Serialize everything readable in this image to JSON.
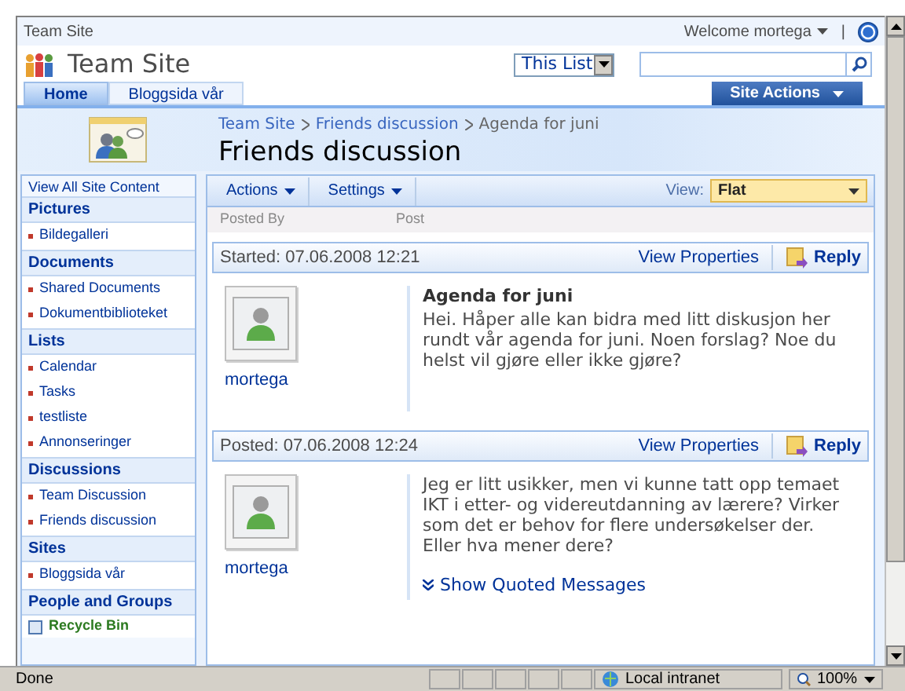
{
  "global_bar": {
    "site": "Team Site",
    "welcome": "Welcome mortega",
    "separator": "|"
  },
  "title_row": {
    "title": "Team Site",
    "scope": "This List"
  },
  "tabs": [
    {
      "label": "Home",
      "selected": true
    },
    {
      "label": "Bloggsida vår",
      "selected": false
    }
  ],
  "site_actions": "Site Actions",
  "breadcrumb": [
    {
      "label": "Team Site",
      "link": true
    },
    {
      "label": "Friends discussion",
      "link": true
    },
    {
      "label": "Agenda for juni",
      "link": false
    }
  ],
  "page_title": "Friends discussion",
  "sidebar": {
    "view_all": "View All Site Content",
    "groups": [
      {
        "title": "Pictures",
        "items": [
          "Bildegalleri"
        ]
      },
      {
        "title": "Documents",
        "items": [
          "Shared Documents",
          "Dokumentbiblioteket"
        ]
      },
      {
        "title": "Lists",
        "items": [
          "Calendar",
          "Tasks",
          "testliste",
          "Annonseringer"
        ]
      },
      {
        "title": "Discussions",
        "items": [
          "Team Discussion",
          "Friends discussion"
        ]
      },
      {
        "title": "Sites",
        "items": [
          "Bloggsida vår"
        ]
      },
      {
        "title": "People and Groups"
      }
    ],
    "recycle_bin": "Recycle Bin"
  },
  "toolbar": {
    "menus": [
      "Actions",
      "Settings"
    ],
    "view_label": "View:",
    "view_value": "Flat"
  },
  "columns": [
    "Posted By",
    "Post"
  ],
  "posts": [
    {
      "stamp": "Started: 07.06.2008 12:21",
      "author": "mortega",
      "subject": "Agenda for juni",
      "body": "Hei. Håper alle kan bidra med litt diskusjon her rundt vår agenda for juni. Noen forslag? Noe du helst vil gjøre eller ikke gjøre?",
      "view_properties": "View Properties",
      "reply": "Reply"
    },
    {
      "stamp": "Posted: 07.06.2008 12:24",
      "author": "mortega",
      "body": "Jeg er litt usikker, men vi kunne tatt opp temaet IKT i etter- og videreutdanning av lærere? Virker som det er behov for flere undersøkelser der. Eller hva mener dere?",
      "quoted": "Show Quoted Messages",
      "view_properties": "View Properties",
      "reply": "Reply"
    }
  ],
  "status_bar": {
    "status": "Done",
    "zone": "Local intranet",
    "zoom": "100%"
  }
}
